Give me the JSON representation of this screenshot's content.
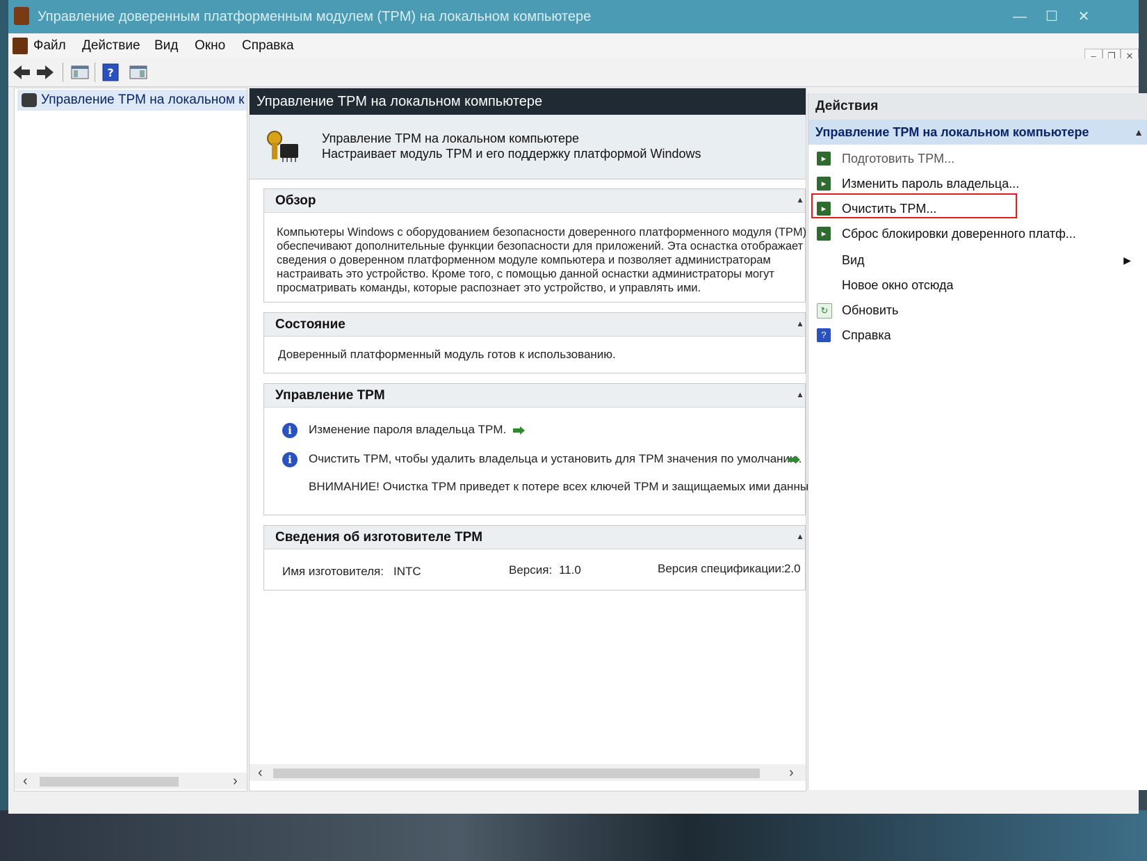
{
  "window": {
    "title": "Управление доверенным платформенным модулем (TPM) на локальном компьютере"
  },
  "menu": [
    "Файл",
    "Действие",
    "Вид",
    "Окно",
    "Справка"
  ],
  "tree": {
    "root_label": "Управление TPM на локальном к"
  },
  "center": {
    "title": "Управление TPM на локальном компьютере",
    "header_line1": "Управление TPM на локальном компьютере",
    "header_line2": "Настраивает модуль TPM и его поддержку платформой Windows",
    "overview": {
      "heading": "Обзор",
      "lines": [
        "Компьютеры Windows с оборудованием безопасности доверенного платформенного модуля (TPM)",
        "обеспечивают дополнительные функции безопасности для приложений. Эта оснастка отображает",
        "сведения о доверенном платформенном модуле компьютера и позволяет администраторам",
        "настраивать это устройство. Кроме того, с помощью данной оснастки администраторы могут",
        "просматривать команды, которые распознает это устройство, и управлять ими."
      ]
    },
    "status": {
      "heading": "Состояние",
      "text": "Доверенный платформенный модуль готов к использованию."
    },
    "tpm_management": {
      "heading": "Управление TPM",
      "item1": "Изменение пароля владельца TPM.",
      "item2": "Очистить TPM, чтобы удалить владельца и установить для TPM значения по умолчанию.",
      "warning": "ВНИМАНИЕ! Очистка TPM приведет к потере всех ключей TPM и защищаемых ими данных."
    },
    "manufacturer": {
      "heading": "Сведения об изготовителе TPM",
      "name_label": "Имя изготовителя:",
      "name_value": "INTC",
      "version_label": "Версия:",
      "version_value": "11.0",
      "spec_label": "Версия спецификации:",
      "spec_value": "2.0"
    }
  },
  "actions": {
    "title": "Действия",
    "subtitle": "Управление TPM на локальном компьютере",
    "items": [
      {
        "label": "Подготовить TPM...",
        "icon": "green-action-icon",
        "disabled": true
      },
      {
        "label": "Изменить пароль владельца...",
        "icon": "green-action-icon"
      },
      {
        "label": "Очистить TPM...",
        "icon": "green-action-icon",
        "highlighted": true
      },
      {
        "label": "Сброс блокировки доверенного платф...",
        "icon": "green-action-icon"
      },
      {
        "label": "Вид",
        "icon": "",
        "submenu": true
      },
      {
        "label": "Новое окно отсюда",
        "icon": ""
      },
      {
        "label": "Обновить",
        "icon": "refresh-icon"
      },
      {
        "label": "Справка",
        "icon": "help-icon"
      }
    ]
  },
  "colors": {
    "titlebar": "#4a9bb3",
    "center_title_bg": "#1f2a33",
    "selection": "#cfe0f2",
    "highlight_box": "#e21b1b"
  }
}
